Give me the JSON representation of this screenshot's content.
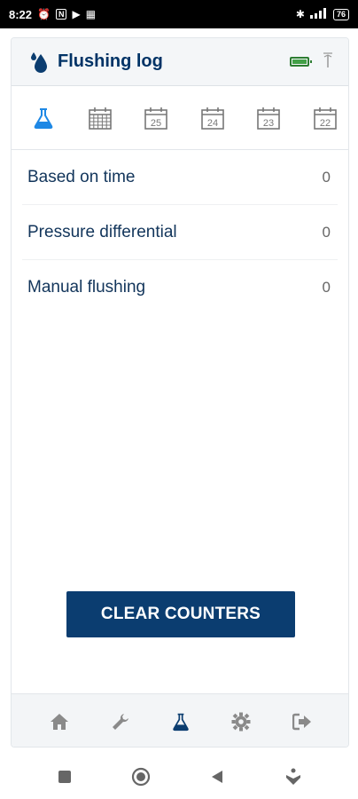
{
  "status_bar": {
    "time": "8:22",
    "notification_icons": [
      "alarm-icon",
      "n-icon",
      "play-icon",
      "app-icon"
    ],
    "battery_level": "76",
    "system_icons": [
      "bluetooth-icon",
      "signal-icon",
      "battery-icon"
    ]
  },
  "header": {
    "title": "Flushing log",
    "icon": "water-drop-icon",
    "status_icons": [
      "device-battery-icon",
      "antenna-icon"
    ]
  },
  "tabs": [
    {
      "icon": "flask-icon",
      "label": "",
      "active": true
    },
    {
      "icon": "calendar-icon",
      "label": "",
      "active": false
    },
    {
      "icon": "calendar-day-icon",
      "label": "25",
      "active": false
    },
    {
      "icon": "calendar-day-icon",
      "label": "24",
      "active": false
    },
    {
      "icon": "calendar-day-icon",
      "label": "23",
      "active": false
    },
    {
      "icon": "calendar-day-icon",
      "label": "22",
      "active": false
    }
  ],
  "rows": [
    {
      "label": "Based on time",
      "value": "0"
    },
    {
      "label": "Pressure differential",
      "value": "0"
    },
    {
      "label": "Manual flushing",
      "value": "0"
    }
  ],
  "actions": {
    "clear_label": "CLEAR COUNTERS"
  },
  "bottom_nav": [
    {
      "icon": "home-icon",
      "active": false
    },
    {
      "icon": "wrench-icon",
      "active": false
    },
    {
      "icon": "flask-icon",
      "active": true
    },
    {
      "icon": "gear-icon",
      "active": false
    },
    {
      "icon": "logout-icon",
      "active": false
    }
  ],
  "colors": {
    "primary": "#0b3d70",
    "accent_blue": "#1e88e5",
    "text_dark": "#12355b",
    "icon_gray": "#8a8a8a",
    "battery_green": "#43a047"
  }
}
